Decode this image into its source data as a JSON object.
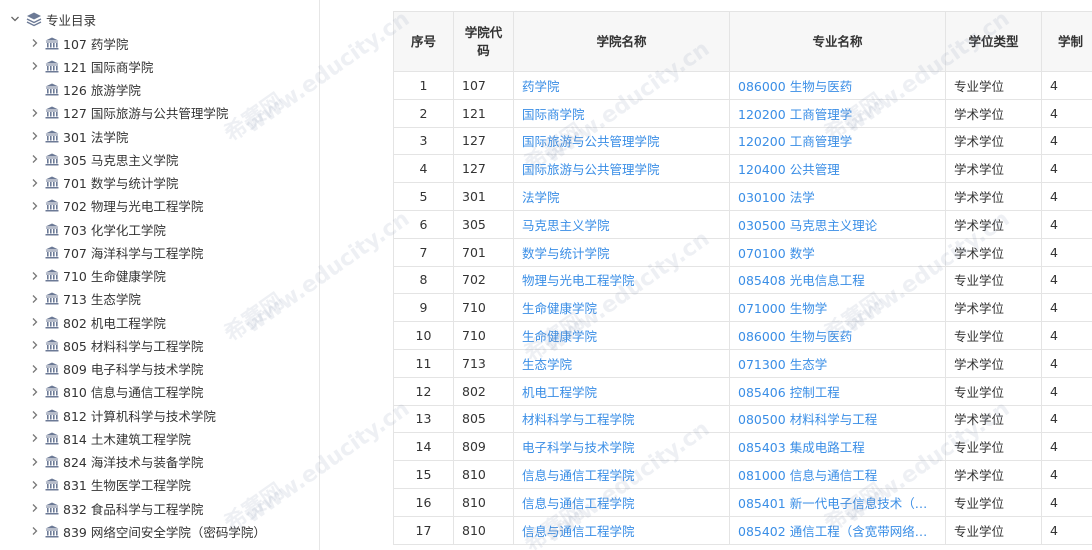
{
  "tree": {
    "root_label": "专业目录",
    "items": [
      {
        "label": "107 药学院",
        "has_children": true
      },
      {
        "label": "121 国际商学院",
        "has_children": true
      },
      {
        "label": "126 旅游学院",
        "has_children": false
      },
      {
        "label": "127 国际旅游与公共管理学院",
        "has_children": true
      },
      {
        "label": "301 法学院",
        "has_children": true
      },
      {
        "label": "305 马克思主义学院",
        "has_children": true
      },
      {
        "label": "701 数学与统计学院",
        "has_children": true
      },
      {
        "label": "702 物理与光电工程学院",
        "has_children": true
      },
      {
        "label": "703 化学化工学院",
        "has_children": false
      },
      {
        "label": "707 海洋科学与工程学院",
        "has_children": false
      },
      {
        "label": "710 生命健康学院",
        "has_children": true
      },
      {
        "label": "713 生态学院",
        "has_children": true
      },
      {
        "label": "802 机电工程学院",
        "has_children": true
      },
      {
        "label": "805 材料科学与工程学院",
        "has_children": true
      },
      {
        "label": "809 电子科学与技术学院",
        "has_children": true
      },
      {
        "label": "810 信息与通信工程学院",
        "has_children": true
      },
      {
        "label": "812 计算机科学与技术学院",
        "has_children": true
      },
      {
        "label": "814 土木建筑工程学院",
        "has_children": true
      },
      {
        "label": "824 海洋技术与装备学院",
        "has_children": true
      },
      {
        "label": "831 生物医学工程学院",
        "has_children": true
      },
      {
        "label": "832 食品科学与工程学院",
        "has_children": true
      },
      {
        "label": "839 网络空间安全学院（密码学院）",
        "has_children": true
      }
    ]
  },
  "table": {
    "headers": [
      "序号",
      "学院代码",
      "学院名称",
      "专业名称",
      "学位类型",
      "学制"
    ],
    "rows": [
      [
        "1",
        "107",
        "药学院",
        "086000 生物与医药",
        "专业学位",
        "4"
      ],
      [
        "2",
        "121",
        "国际商学院",
        "120200 工商管理学",
        "学术学位",
        "4"
      ],
      [
        "3",
        "127",
        "国际旅游与公共管理学院",
        "120200 工商管理学",
        "学术学位",
        "4"
      ],
      [
        "4",
        "127",
        "国际旅游与公共管理学院",
        "120400 公共管理",
        "学术学位",
        "4"
      ],
      [
        "5",
        "301",
        "法学院",
        "030100 法学",
        "学术学位",
        "4"
      ],
      [
        "6",
        "305",
        "马克思主义学院",
        "030500 马克思主义理论",
        "学术学位",
        "4"
      ],
      [
        "7",
        "701",
        "数学与统计学院",
        "070100 数学",
        "学术学位",
        "4"
      ],
      [
        "8",
        "702",
        "物理与光电工程学院",
        "085408 光电信息工程",
        "专业学位",
        "4"
      ],
      [
        "9",
        "710",
        "生命健康学院",
        "071000 生物学",
        "学术学位",
        "4"
      ],
      [
        "10",
        "710",
        "生命健康学院",
        "086000 生物与医药",
        "专业学位",
        "4"
      ],
      [
        "11",
        "713",
        "生态学院",
        "071300 生态学",
        "学术学位",
        "4"
      ],
      [
        "12",
        "802",
        "机电工程学院",
        "085406 控制工程",
        "专业学位",
        "4"
      ],
      [
        "13",
        "805",
        "材料科学与工程学院",
        "080500 材料科学与工程",
        "学术学位",
        "4"
      ],
      [
        "14",
        "809",
        "电子科学与技术学院",
        "085403 集成电路工程",
        "专业学位",
        "4"
      ],
      [
        "15",
        "810",
        "信息与通信工程学院",
        "081000 信息与通信工程",
        "学术学位",
        "4"
      ],
      [
        "16",
        "810",
        "信息与通信工程学院",
        "085401 新一代电子信息技术（含…",
        "专业学位",
        "4"
      ],
      [
        "17",
        "810",
        "信息与通信工程学院",
        "085402 通信工程（含宽带网络、…",
        "专业学位",
        "4"
      ]
    ]
  },
  "watermark": {
    "text": "www.educity.cn",
    "brand": "希赛网"
  },
  "colors": {
    "link": "#3a8ee6",
    "header_bg": "#f7f7f7",
    "border": "#e4e4e4",
    "icon": "#6c7a96"
  }
}
